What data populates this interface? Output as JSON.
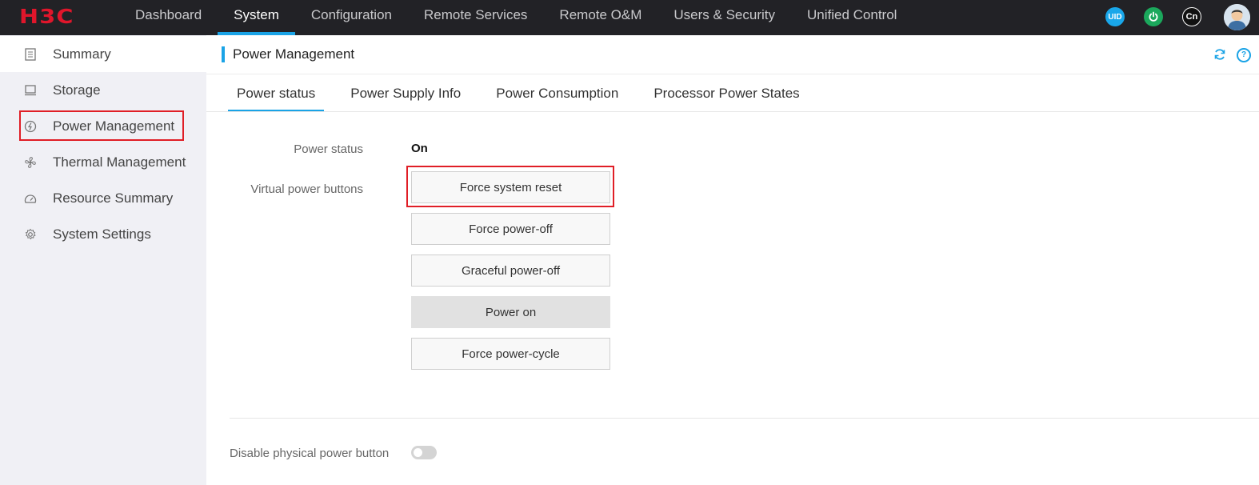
{
  "brand": {
    "logo_text": "H3C",
    "logo_color": "#e0162b"
  },
  "nav": {
    "items": [
      {
        "label": "Dashboard"
      },
      {
        "label": "System",
        "active": true
      },
      {
        "label": "Configuration"
      },
      {
        "label": "Remote Services"
      },
      {
        "label": "Remote O&M"
      },
      {
        "label": "Users & Security"
      },
      {
        "label": "Unified Control"
      }
    ],
    "icons": {
      "uid_label": "UID",
      "lang_label": "Cn"
    }
  },
  "sidebar": {
    "items": [
      {
        "label": "Summary",
        "icon": "summary-icon"
      },
      {
        "label": "Storage",
        "icon": "storage-icon"
      },
      {
        "label": "Power Management",
        "icon": "power-management-icon",
        "active": true
      },
      {
        "label": "Thermal Management",
        "icon": "fan-icon"
      },
      {
        "label": "Resource Summary",
        "icon": "gauge-icon"
      },
      {
        "label": "System Settings",
        "icon": "gear-icon"
      }
    ]
  },
  "page": {
    "title": "Power Management"
  },
  "tabs": [
    {
      "label": "Power status",
      "active": true
    },
    {
      "label": "Power Supply Info"
    },
    {
      "label": "Power Consumption"
    },
    {
      "label": "Processor Power States"
    }
  ],
  "power": {
    "status_label": "Power status",
    "status_value": "On",
    "virtual_buttons_label": "Virtual power buttons",
    "buttons": [
      {
        "label": "Force system reset"
      },
      {
        "label": "Force power-off"
      },
      {
        "label": "Graceful power-off"
      },
      {
        "label": "Power on",
        "disabled": true
      },
      {
        "label": "Force power-cycle"
      }
    ],
    "disable_physical_label": "Disable physical power button",
    "disable_physical_enabled": false
  },
  "colors": {
    "accent": "#1aa3e6",
    "highlight": "#e01e26",
    "topbar": "#222226"
  }
}
